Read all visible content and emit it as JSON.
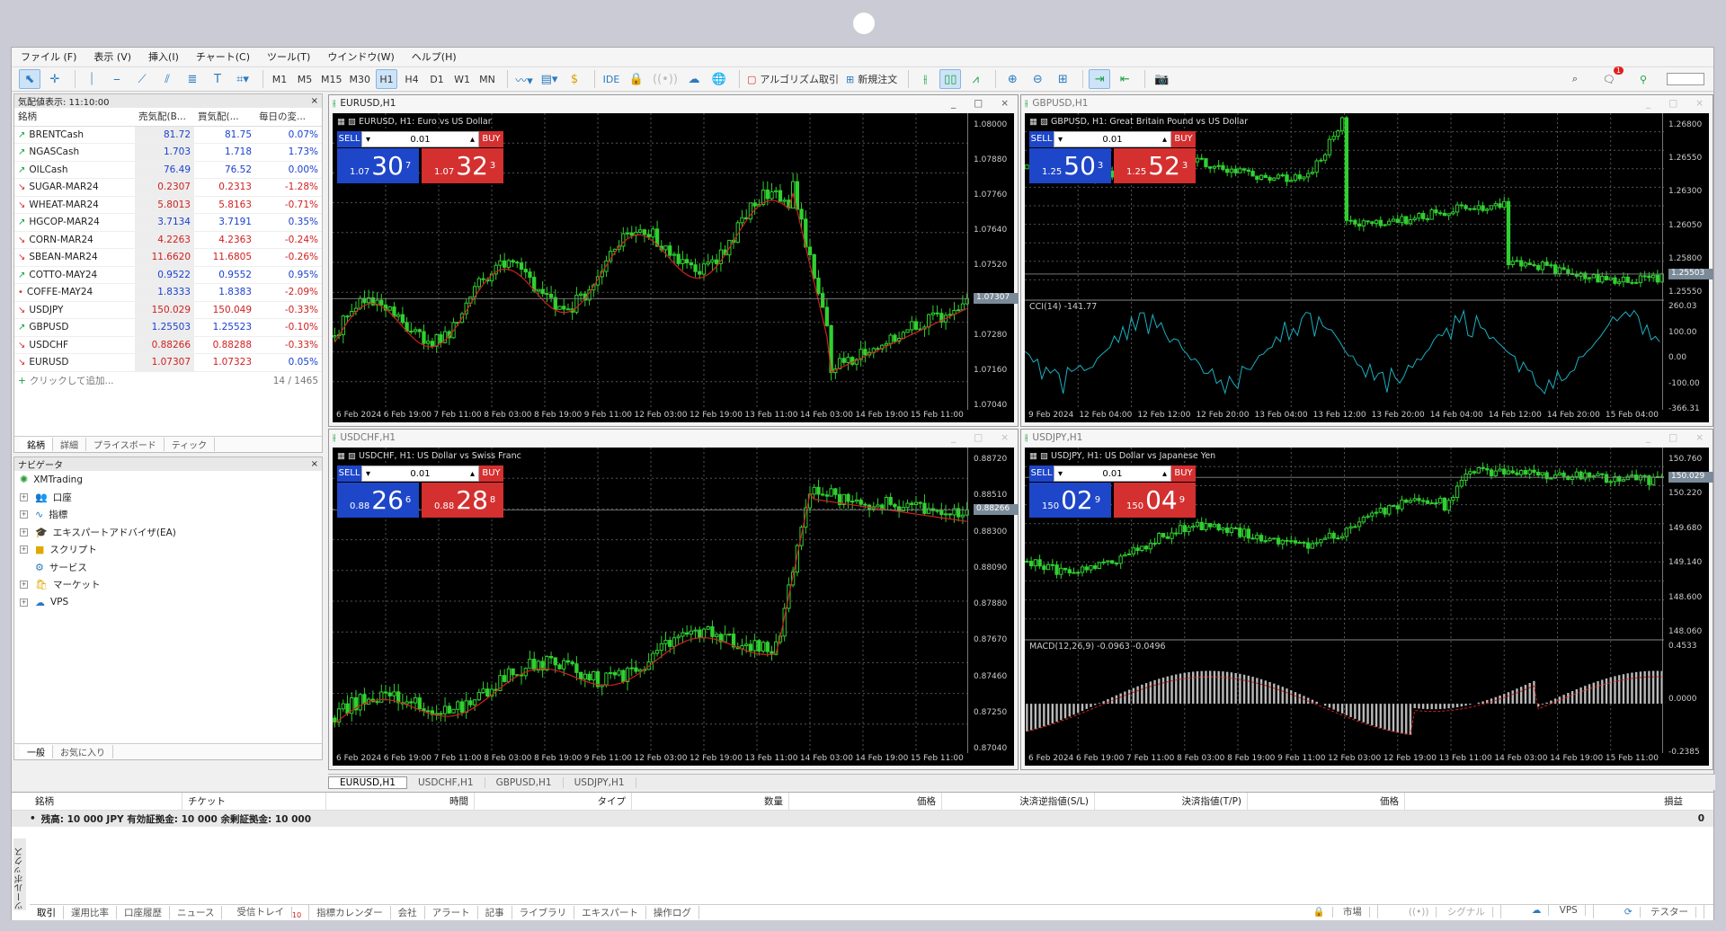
{
  "menu": [
    "ファイル (F)",
    "表示 (V)",
    "挿入(I)",
    "チャート(C)",
    "ツール(T)",
    "ウインドウ(W)",
    "ヘルプ(H)"
  ],
  "toolbar": {
    "timeframes": [
      "M1",
      "M5",
      "M15",
      "M30",
      "H1",
      "H4",
      "D1",
      "W1",
      "MN"
    ],
    "active_timeframe": "H1",
    "ide": "IDE",
    "algo": "アルゴリズム取引",
    "new_order": "新規注文",
    "notifications": "1"
  },
  "market_watch": {
    "title": "気配値表示: 11:10:00",
    "columns": [
      "銘柄",
      "売気配(B...",
      "買気配(...",
      "毎日の変..."
    ],
    "rows": [
      {
        "dir": "up",
        "symbol": "BRENTCash",
        "bid": "81.72",
        "ask": "81.75",
        "change": "0.07%"
      },
      {
        "dir": "up",
        "symbol": "NGASCash",
        "bid": "1.703",
        "ask": "1.718",
        "change": "1.73%"
      },
      {
        "dir": "up",
        "symbol": "OILCash",
        "bid": "76.49",
        "ask": "76.52",
        "change": "0.00%"
      },
      {
        "dir": "down",
        "symbol": "SUGAR-MAR24",
        "bid": "0.2307",
        "ask": "0.2313",
        "change": "-1.28%"
      },
      {
        "dir": "down",
        "symbol": "WHEAT-MAR24",
        "bid": "5.8013",
        "ask": "5.8163",
        "change": "-0.71%"
      },
      {
        "dir": "up",
        "symbol": "HGCOP-MAR24",
        "bid": "3.7134",
        "ask": "3.7191",
        "change": "0.35%"
      },
      {
        "dir": "down",
        "symbol": "CORN-MAR24",
        "bid": "4.2263",
        "ask": "4.2363",
        "change": "-0.24%"
      },
      {
        "dir": "down",
        "symbol": "SBEAN-MAR24",
        "bid": "11.6620",
        "ask": "11.6805",
        "change": "-0.26%"
      },
      {
        "dir": "up",
        "symbol": "COTTO-MAY24",
        "bid": "0.9522",
        "ask": "0.9552",
        "change": "0.95%"
      },
      {
        "dir": "none",
        "symbol": "COFFE-MAY24",
        "bid": "1.8333",
        "ask": "1.8383",
        "change": "-2.09%"
      },
      {
        "dir": "down",
        "symbol": "USDJPY",
        "bid": "150.029",
        "ask": "150.049",
        "change": "-0.33%"
      },
      {
        "dir": "up",
        "symbol": "GBPUSD",
        "bid": "1.25503",
        "ask": "1.25523",
        "change": "-0.10%"
      },
      {
        "dir": "down",
        "symbol": "USDCHF",
        "bid": "0.88266",
        "ask": "0.88288",
        "change": "-0.33%"
      },
      {
        "dir": "down",
        "symbol": "EURUSD",
        "bid": "1.07307",
        "ask": "1.07323",
        "change": "0.05%"
      }
    ],
    "add_label": "クリックして追加...",
    "count": "14 / 1465",
    "tabs": [
      "銘柄",
      "詳細",
      "プライスボード",
      "ティック"
    ]
  },
  "navigator": {
    "title": "ナビゲータ",
    "root": "XMTrading",
    "items": [
      "口座",
      "指標",
      "エキスパートアドバイザ(EA)",
      "スクリプト",
      "サービス",
      "マーケット",
      "VPS"
    ],
    "tabs": [
      "一般",
      "お気に入り"
    ]
  },
  "charts": [
    {
      "title": "EURUSD,H1",
      "info": "EURUSD, H1:  Euro vs US Dollar",
      "lot": "0.01",
      "sell_small": "1.07",
      "sell_big": "30",
      "sell_sup": "7",
      "buy_small": "1.07",
      "buy_big": "32",
      "buy_sup": "3",
      "yticks": [
        "1.08000",
        "1.07880",
        "1.07760",
        "1.07640",
        "1.07520",
        "1.07400",
        "1.07280",
        "1.07160",
        "1.07040"
      ],
      "current": "1.07307",
      "xticks": [
        "6 Feb 2024",
        "6 Feb 19:00",
        "7 Feb 11:00",
        "8 Feb 03:00",
        "8 Feb 19:00",
        "9 Feb 11:00",
        "12 Feb 03:00",
        "12 Feb 19:00",
        "13 Feb 11:00",
        "14 Feb 03:00",
        "14 Feb 19:00",
        "15 Feb 11:00"
      ]
    },
    {
      "title": "GBPUSD,H1",
      "info": "GBPUSD, H1:  Great Britain Pound vs US Dollar",
      "lot": "0.01",
      "sell_small": "1.25",
      "sell_big": "50",
      "sell_sup": "3",
      "buy_small": "1.25",
      "buy_big": "52",
      "buy_sup": "3",
      "yticks": [
        "1.26800",
        "1.26550",
        "1.26300",
        "1.26050",
        "1.25800",
        "1.25550"
      ],
      "current": "1.25503",
      "indicator": "CCI(14) -141.77",
      "ind_ticks": [
        "260.03",
        "100.00",
        "0.00",
        "-100.00",
        "-366.31"
      ],
      "xticks": [
        "9 Feb 2024",
        "12 Feb 04:00",
        "12 Feb 12:00",
        "12 Feb 20:00",
        "13 Feb 04:00",
        "13 Feb 12:00",
        "13 Feb 20:00",
        "14 Feb 04:00",
        "14 Feb 12:00",
        "14 Feb 20:00",
        "15 Feb 04:00"
      ]
    },
    {
      "title": "USDCHF,H1",
      "info": "USDCHF, H1:  US Dollar vs Swiss Franc",
      "lot": "0.01",
      "sell_small": "0.88",
      "sell_big": "26",
      "sell_sup": "6",
      "buy_small": "0.88",
      "buy_big": "28",
      "buy_sup": "8",
      "yticks": [
        "0.88720",
        "0.88510",
        "0.88300",
        "0.88090",
        "0.87880",
        "0.87670",
        "0.87460",
        "0.87250",
        "0.87040"
      ],
      "current": "0.88266",
      "xticks": [
        "6 Feb 2024",
        "6 Feb 19:00",
        "7 Feb 11:00",
        "8 Feb 03:00",
        "8 Feb 19:00",
        "9 Feb 11:00",
        "12 Feb 03:00",
        "12 Feb 19:00",
        "13 Feb 11:00",
        "14 Feb 03:00",
        "14 Feb 19:00",
        "15 Feb 11:00"
      ]
    },
    {
      "title": "USDJPY,H1",
      "info": "USDJPY, H1:  US Dollar vs Japanese Yen",
      "lot": "0.01",
      "sell_small": "150",
      "sell_big": "02",
      "sell_sup": "9",
      "buy_small": "150",
      "buy_big": "04",
      "buy_sup": "9",
      "yticks": [
        "150.760",
        "150.220",
        "149.680",
        "149.140",
        "148.600",
        "148.060"
      ],
      "current": "150.029",
      "indicator": "MACD(12,26,9) -0.0963 -0.0496",
      "ind_ticks": [
        "0.4533",
        "0.0000",
        "-0.2385"
      ],
      "xticks": [
        "6 Feb 2024",
        "6 Feb 19:00",
        "7 Feb 11:00",
        "8 Feb 03:00",
        "8 Feb 19:00",
        "9 Feb 11:00",
        "12 Feb 03:00",
        "12 Feb 19:00",
        "13 Feb 11:00",
        "14 Feb 03:00",
        "14 Feb 19:00",
        "15 Feb 11:00"
      ]
    }
  ],
  "chart_tabs": [
    "EURUSD,H1",
    "USDCHF,H1",
    "GBPUSD,H1",
    "USDJPY,H1"
  ],
  "terminal": {
    "columns": [
      "銘柄",
      "チケット",
      "時間",
      "タイプ",
      "数量",
      "価格",
      "決済逆指値(S/L)",
      "決済指値(T/P)",
      "価格",
      "損益"
    ],
    "balance": "残高: 10 000 JPY  有効証拠金: 10 000  余剰証拠金: 10 000",
    "balance_value": "0",
    "tabs": [
      "取引",
      "運用比率",
      "口座履歴",
      "ニュース",
      "受信トレイ",
      "指標カレンダー",
      "会社",
      "アラート",
      "記事",
      "ライブラリ",
      "エキスパート",
      "操作ログ"
    ],
    "inbox_count": "10",
    "side_label": "ツールボックス"
  },
  "status": [
    "市場",
    "シグナル",
    "VPS",
    "テスター"
  ]
}
